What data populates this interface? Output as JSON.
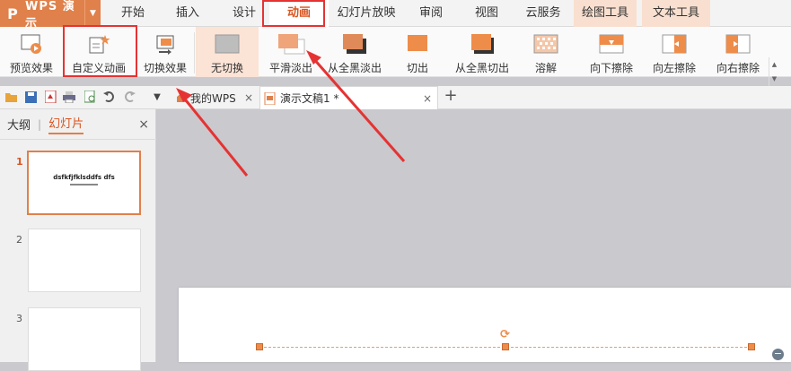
{
  "app": {
    "logo": "P",
    "name": "WPS 演示",
    "dropdown": "▼"
  },
  "menu_tabs": [
    "开始",
    "插入",
    "设计",
    "动画",
    "幻灯片放映",
    "审阅",
    "视图",
    "云服务",
    "绘图工具",
    "文本工具"
  ],
  "ribbon": {
    "buttons": [
      "预览效果",
      "自定义动画",
      "切换效果",
      "无切换",
      "平滑淡出",
      "从全黑淡出",
      "切出",
      "从全黑切出",
      "溶解",
      "向下擦除",
      "向左擦除",
      "向右擦除"
    ],
    "selected": "无切换"
  },
  "doc_tabs": {
    "dropdown": "▼",
    "tabs": [
      "我的WPS",
      "演示文稿1 *"
    ],
    "close": "×",
    "new": "+"
  },
  "side_panel": {
    "tabs": [
      "大纲",
      "幻灯片"
    ],
    "separator": "|",
    "close": "×",
    "slides": [
      {
        "number": "1",
        "title": "dsfkfjfklsddfs dfs"
      },
      {
        "number": "2",
        "title": ""
      },
      {
        "number": "3",
        "title": ""
      }
    ]
  },
  "canvas": {
    "rotate_handle": "⟳",
    "minus": "−"
  },
  "colors": {
    "accent": "#e0804a",
    "highlight": "#e53333",
    "tool_tab": "#f9dfcf"
  }
}
